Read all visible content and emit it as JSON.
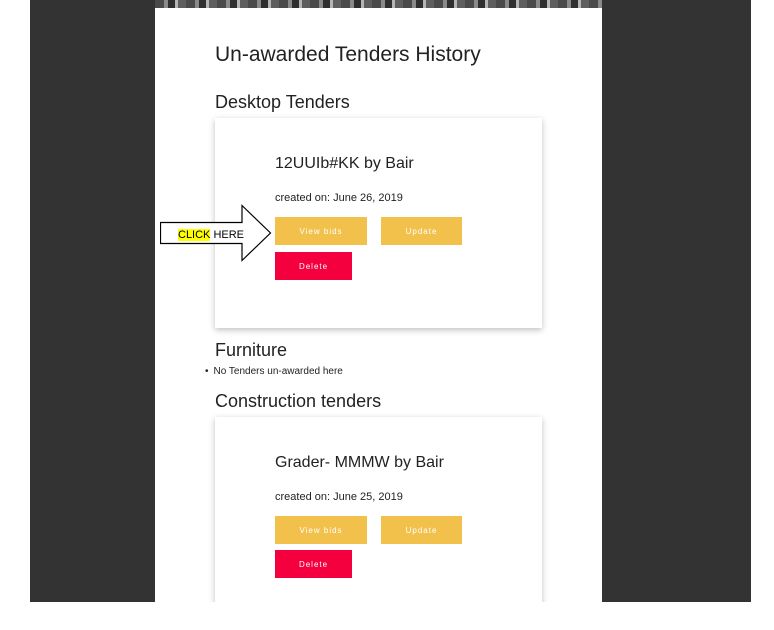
{
  "page_title": "Un-awarded Tenders History",
  "sections": [
    {
      "heading": "Desktop Tenders",
      "tenders": [
        {
          "title": "12UUIb#KK by Bair",
          "created": "created on: June 26, 2019",
          "view_bids_label": "View bids",
          "update_label": "Update",
          "delete_label": "Delete"
        }
      ]
    },
    {
      "heading": "Furniture",
      "empty_message": "No Tenders un-awarded here"
    },
    {
      "heading": "Construction tenders",
      "tenders": [
        {
          "title": "Grader- MMMW by Bair",
          "created": "created on: June 25, 2019",
          "view_bids_label": "View bids",
          "update_label": "Update",
          "delete_label": "Delete"
        }
      ]
    }
  ],
  "annotation": {
    "highlight_word": "CLICK",
    "rest": " HERE"
  },
  "colors": {
    "button_yellow": "#f2c14c",
    "button_red": "#f5003e",
    "outer_background": "#333333"
  }
}
